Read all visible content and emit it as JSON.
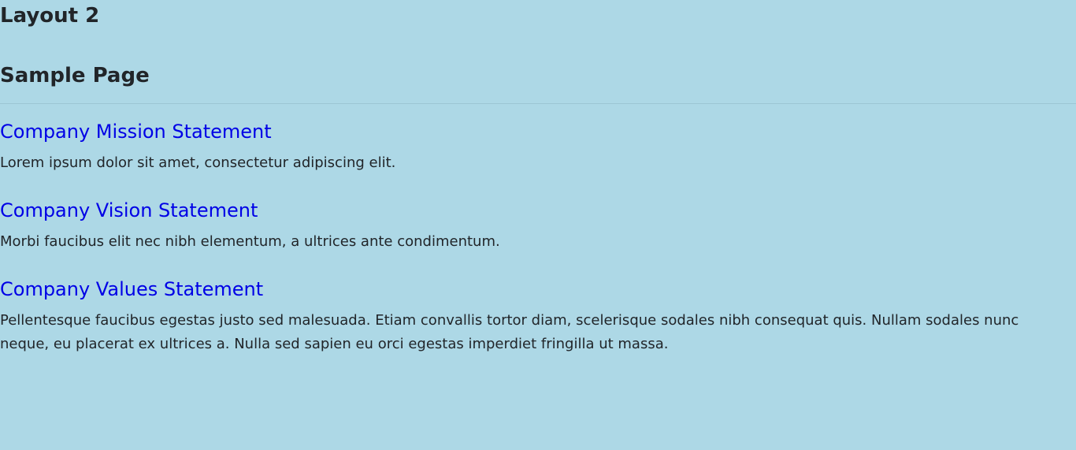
{
  "header": {
    "layout_title": "Layout 2",
    "page_title": "Sample Page"
  },
  "sections": [
    {
      "title": "Company Mission Statement",
      "text": "Lorem ipsum dolor sit amet, consectetur adipiscing elit."
    },
    {
      "title": "Company Vision Statement",
      "text": "Morbi faucibus elit nec nibh elementum, a ultrices ante condimentum."
    },
    {
      "title": "Company Values Statement",
      "text": "Pellentesque faucibus egestas justo sed malesuada. Etiam convallis tortor diam, scelerisque sodales nibh consequat quis. Nullam sodales nunc neque, eu placerat ex ultrices a. Nulla sed sapien eu orci egestas imperdiet fringilla ut massa."
    }
  ],
  "colors": {
    "background": "#add8e6",
    "link": "#0000e6",
    "text": "#212529"
  }
}
